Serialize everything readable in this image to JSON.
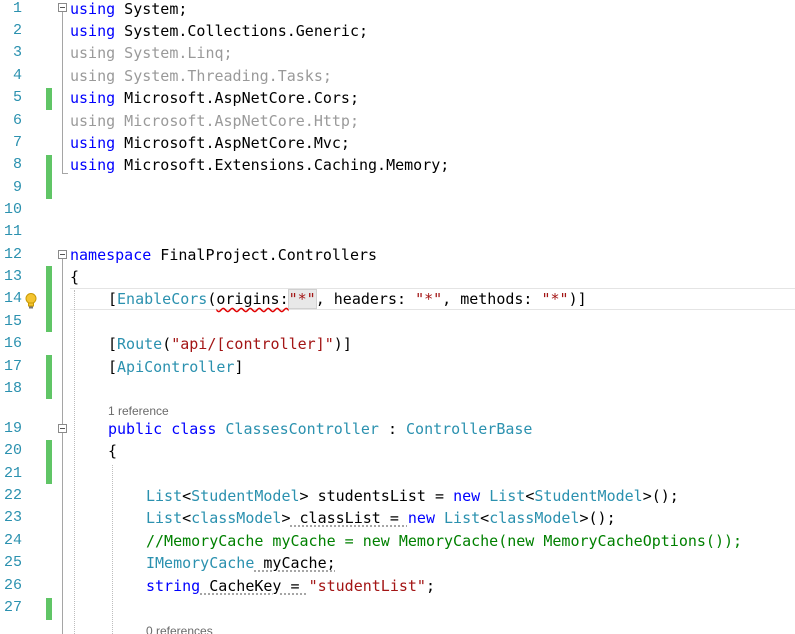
{
  "editor": {
    "colors": {
      "keyword": "#0000ff",
      "type": "#2b91af",
      "string": "#a31515",
      "comment": "#008000",
      "unused_using": "#9a9a9a",
      "line_number": "#2b91af",
      "change_marker": "#60c566"
    },
    "line_numbers": [
      "1",
      "2",
      "3",
      "4",
      "5",
      "6",
      "7",
      "8",
      "9",
      "10",
      "11",
      "12",
      "13",
      "14",
      "15",
      "16",
      "17",
      "18",
      "19",
      "20",
      "21",
      "22",
      "23",
      "24",
      "25",
      "26",
      "27"
    ],
    "tokens": {
      "using": "using",
      "ns1": " System;",
      "ns2": " System.Collections.Generic;",
      "ns3": " System.Linq;",
      "ns4": " System.Threading.Tasks;",
      "ns5": " Microsoft.AspNetCore.Cors;",
      "ns6": " Microsoft.AspNetCore.Http;",
      "ns7": " Microsoft.AspNetCore.Mvc;",
      "ns8": " Microsoft.Extensions.Caching.Memory;",
      "namespace_kw": "namespace",
      "namespace_name": " FinalProject.Controllers",
      "open_brace": "{",
      "lbracket": "[",
      "rbracket": "]",
      "enable_cors": "EnableCors",
      "lparen": "(",
      "rparen": ")",
      "origins": "origins",
      "colon": ":",
      "star": "\"*\"",
      "headers": ", headers: ",
      "methods": ", methods: ",
      "route": "Route",
      "route_value": "\"api/[controller]\"",
      "api_controller": "ApiController",
      "public": "public",
      "class": "class",
      "controller_name": "ClassesController",
      "colon_sep": " : ",
      "controller_base": "ControllerBase",
      "list": "List",
      "lt": "<",
      "gt": ">",
      "student_model": "StudentModel",
      "class_model": "classModel",
      "students_list_decl": " studentsList = ",
      "class_list_decl": " classList = ",
      "new": "new",
      "call_end": "();",
      "comment_line": "//MemoryCache myCache = new MemoryCache(new MemoryCacheOptions());",
      "imemory_cache": "IMemoryCache",
      "my_cache": " myCache;",
      "string": "string",
      "cache_key": " CacheKey = ",
      "student_list_str": "\"studentList\"",
      "semicolon": ";"
    },
    "codelens": {
      "class_references": "1 reference",
      "next_references": "0 references"
    },
    "lightbulb_icon": "lightbulb-icon"
  }
}
